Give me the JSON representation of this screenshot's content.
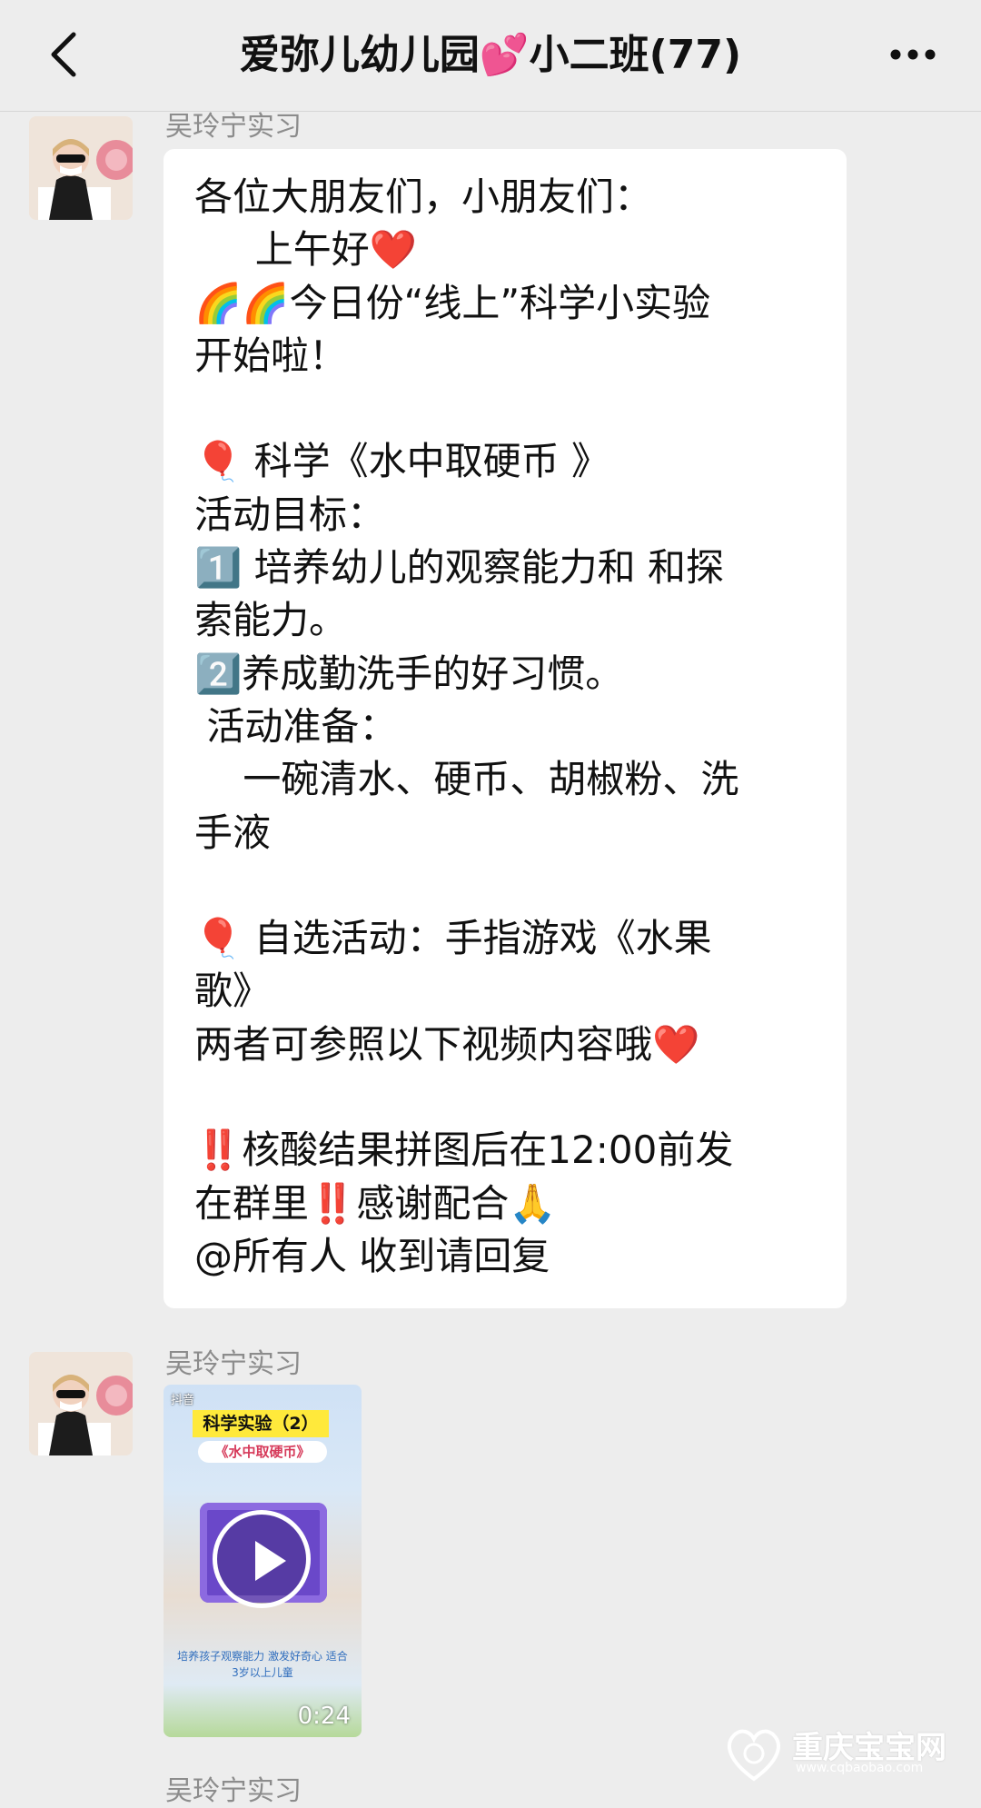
{
  "header": {
    "title": "爱弥儿幼儿园💕小二班(77)",
    "back_icon": "chevron-left-icon",
    "more_icon": "more-dots-icon"
  },
  "messages": [
    {
      "sender": "吴玲宁实习",
      "lines": [
        "各位大朋友们，小朋友们：",
        "     上午好❤️",
        "🌈🌈今日份“线上”科学小实验",
        "开始啦！",
        "",
        "🎈 科学《水中取硬币 》",
        "活动目标：",
        "1️⃣ 培养幼儿的观察能力和 和探",
        "索能力。",
        "2️⃣养成勤洗手的好习惯。",
        " 活动准备：",
        "    一碗清水、硬币、胡椒粉、洗",
        "手液",
        "",
        "🎈 自选活动：手指游戏《水果",
        "歌》",
        "两者可参照以下视频内容哦❤️",
        "",
        "‼️核酸结果拼图后在12:00前发",
        "在群里‼️感谢配合🙏",
        "@所有人 收到请回复"
      ]
    },
    {
      "sender": "吴玲宁实习",
      "video": {
        "source": "抖音",
        "caption": "科学实验（2）",
        "subtitle": "《水中取硬币》",
        "tagline": "培养孩子观察能力 激发好奇心 适合3岁以上儿童",
        "duration": "0:24"
      }
    },
    {
      "sender": "吴玲宁实习"
    }
  ],
  "watermark": {
    "text": "重庆宝宝网",
    "url": "www.cqbaobao.com"
  },
  "colors": {
    "background": "#ededed",
    "bubble": "#ffffff",
    "sender_text": "#8c8c8c"
  }
}
